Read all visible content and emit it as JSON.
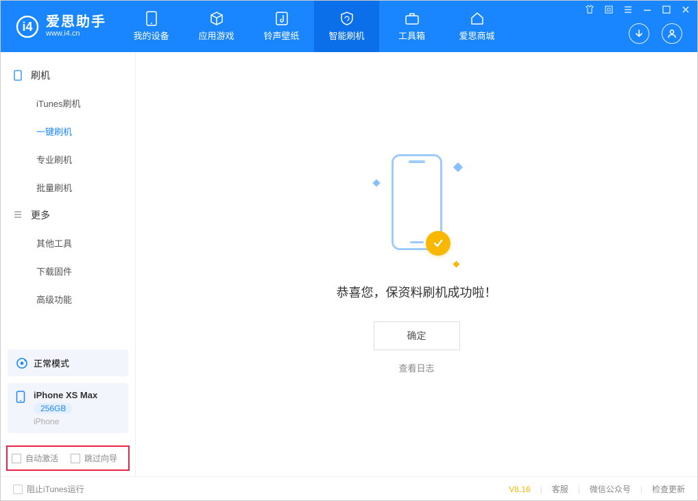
{
  "header": {
    "app_name": "爱思助手",
    "app_url": "www.i4.cn",
    "tabs": [
      {
        "id": "device",
        "label": "我的设备"
      },
      {
        "id": "apps",
        "label": "应用游戏"
      },
      {
        "id": "ringtone",
        "label": "铃声壁纸"
      },
      {
        "id": "flash",
        "label": "智能刷机"
      },
      {
        "id": "toolbox",
        "label": "工具箱"
      },
      {
        "id": "store",
        "label": "爱思商城"
      }
    ]
  },
  "sidebar": {
    "group_flash": "刷机",
    "items_flash": [
      "iTunes刷机",
      "一键刷机",
      "专业刷机",
      "批量刷机"
    ],
    "group_more": "更多",
    "items_more": [
      "其他工具",
      "下载固件",
      "高级功能"
    ],
    "mode_card": {
      "label": "正常模式"
    },
    "device_card": {
      "name": "iPhone XS Max",
      "capacity": "256GB",
      "type": "iPhone"
    },
    "check_auto_activate": "自动激活",
    "check_skip_guide": "跳过向导"
  },
  "main": {
    "success_msg": "恭喜您，保资料刷机成功啦！",
    "ok_label": "确定",
    "view_log": "查看日志"
  },
  "footer": {
    "block_itunes": "阻止iTunes运行",
    "version": "V8.16",
    "links": [
      "客服",
      "微信公众号",
      "检查更新"
    ]
  }
}
